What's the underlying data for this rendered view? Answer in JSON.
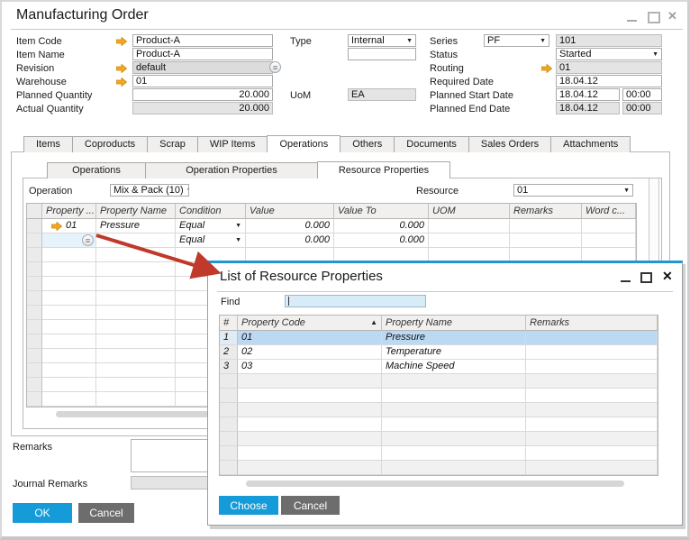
{
  "window": {
    "title": "Manufacturing Order"
  },
  "icons": {
    "dropdown_caret": "▼",
    "sort_ascending": "▲",
    "close_glyph": "✕",
    "ellipsis_glyph": "≡"
  },
  "form": {
    "item_code_label": "Item Code",
    "item_code_value": "Product-A",
    "item_name_label": "Item Name",
    "item_name_value": "Product-A",
    "revision_label": "Revision",
    "revision_value": "default",
    "warehouse_label": "Warehouse",
    "warehouse_value": "01",
    "planned_qty_label": "Planned Quantity",
    "planned_qty_value": "20.000",
    "actual_qty_label": "Actual Quantity",
    "actual_qty_value": "20.000",
    "type_label": "Type",
    "type_value": "Internal",
    "uom_label": "UoM",
    "uom_value": "EA",
    "series_label": "Series",
    "series_value": "PF",
    "series_number": "101",
    "status_label": "Status",
    "status_value": "Started",
    "routing_label": "Routing",
    "routing_value": "01",
    "required_date_label": "Required Date",
    "required_date_value": "18.04.12",
    "planned_start_label": "Planned Start Date",
    "planned_start_date": "18.04.12",
    "planned_start_time": "00:00",
    "planned_end_label": "Planned End Date",
    "planned_end_date": "18.04.12",
    "planned_end_time": "00:00"
  },
  "tabs": {
    "items": [
      "Items",
      "Coproducts",
      "Scrap",
      "WIP Items",
      "Operations",
      "Others",
      "Documents",
      "Sales Orders",
      "Attachments"
    ],
    "active": "Operations"
  },
  "subtabs": {
    "items": [
      "Operations",
      "Operation Properties",
      "Resource Properties"
    ],
    "active": "Resource Properties"
  },
  "operation": {
    "label": "Operation",
    "value": "Mix & Pack (10)",
    "resource_label": "Resource",
    "resource_value": "01"
  },
  "grid": {
    "columns": [
      "Property ...",
      "Property Name",
      "Condition",
      "Value",
      "Value To",
      "UOM",
      "Remarks",
      "Word c..."
    ],
    "rows": [
      {
        "property": "01",
        "name": "Pressure",
        "condition": "Equal",
        "value": "0.000",
        "value_to": "0.000",
        "uom": "",
        "remarks": "",
        "word": ""
      },
      {
        "property": "",
        "name": "",
        "condition": "Equal",
        "value": "0.000",
        "value_to": "0.000",
        "uom": "",
        "remarks": "",
        "word": ""
      }
    ]
  },
  "footer": {
    "remarks_label": "Remarks",
    "journal_remarks_label": "Journal Remarks",
    "ok_label": "OK",
    "cancel_label": "Cancel"
  },
  "dialog": {
    "title": "List of Resource Properties",
    "find_label": "Find",
    "columns": [
      "#",
      "Property Code",
      "Property Name",
      "Remarks"
    ],
    "rows": [
      {
        "num": "1",
        "code": "01",
        "name": "Pressure",
        "remarks": ""
      },
      {
        "num": "2",
        "code": "02",
        "name": "Temperature",
        "remarks": ""
      },
      {
        "num": "3",
        "code": "03",
        "name": "Machine Speed",
        "remarks": ""
      }
    ],
    "selected_row": "1",
    "choose_label": "Choose",
    "cancel_label": "Cancel"
  },
  "colors": {
    "accent_blue": "#159BD7",
    "dialog_accent_blue": "#2396D2",
    "selection_blue": "#BCD9F4",
    "cell_selection_blue": "#E7F3FB",
    "link_arrow_orange": "#F5A81C",
    "annotation_arrow_red": "#C0392B",
    "button_gray": "#6D6D6D",
    "disabled_field_gray": "#E4E4E4"
  }
}
